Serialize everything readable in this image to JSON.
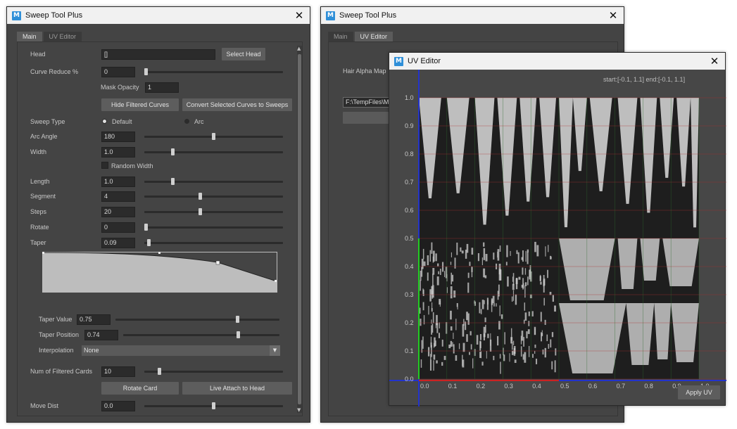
{
  "app_icon_letter": "M",
  "close_glyph": "✕",
  "left_window": {
    "title": "Sweep Tool Plus",
    "tabs": [
      {
        "label": "Main",
        "active": true
      },
      {
        "label": "UV Editor",
        "active": false
      }
    ],
    "head": {
      "label": "Head",
      "value": "[]",
      "button": "Select Head"
    },
    "curve_reduce": {
      "label": "Curve Reduce %",
      "value": "0",
      "slider": 0.0
    },
    "mask_opacity": {
      "label": "Mask Opacity",
      "value": "1"
    },
    "hide_filtered_button": "Hide Filtered Curves",
    "convert_button": "Convert Selected Curves to Sweeps",
    "sweep_type": {
      "label": "Sweep Type",
      "options": [
        "Default",
        "Arc"
      ],
      "selected": "Default"
    },
    "arc_angle": {
      "label": "Arc Angle",
      "value": "180",
      "slider": 0.5
    },
    "width": {
      "label": "Width",
      "value": "1.0",
      "slider": 0.2
    },
    "random_width": {
      "label": "Random Width",
      "checked": false
    },
    "length": {
      "label": "Length",
      "value": "1.0",
      "slider": 0.2
    },
    "segment": {
      "label": "Segment",
      "value": "4",
      "slider": 0.4
    },
    "steps": {
      "label": "Steps",
      "value": "20",
      "slider": 0.4
    },
    "rotate": {
      "label": "Rotate",
      "value": "0",
      "slider": 0.0
    },
    "taper": {
      "label": "Taper",
      "value": "0.09",
      "slider": 0.02
    },
    "taper_value": {
      "label": "Taper Value",
      "value": "0.75",
      "slider": 0.75
    },
    "taper_position": {
      "label": "Taper Position",
      "value": "0.74",
      "slider": 0.74
    },
    "interpolation": {
      "label": "Interpolation",
      "value": "None"
    },
    "num_filtered": {
      "label": "Num of Filtered Cards",
      "value": "10",
      "slider": 0.1
    },
    "rotate_card_button": "Rotate Card",
    "live_attach_button": "Live Attach to Head",
    "move_dist": {
      "label": "Move Dist",
      "value": "0.0",
      "slider": 0.5
    }
  },
  "right_window": {
    "title": "Sweep Tool Plus",
    "tabs": [
      {
        "label": "Main",
        "active": false
      },
      {
        "label": "UV Editor",
        "active": true
      }
    ],
    "hair_alpha_label": "Hair Alpha Map",
    "path_value": "F:\\TempFiles\\M"
  },
  "uv_editor": {
    "title": "UV Editor",
    "readout": "start:[-0.1, 1.1] end:[-0.1, 1.1]",
    "apply_button": "Apply UV",
    "colors": {
      "x_axis": "#2233cc",
      "y_axis": "#2233cc",
      "u_edge": "#cc2222",
      "v_edge": "#22cc22",
      "grid": "#b03030"
    },
    "y_ticks": [
      "0.0",
      "0.1",
      "0.2",
      "0.3",
      "0.4",
      "0.5",
      "0.6",
      "0.7",
      "0.8",
      "0.9",
      "1.0"
    ],
    "x_ticks": [
      "0.0",
      "0.1",
      "0.2",
      "0.3",
      "0.4",
      "0.5",
      "0.6",
      "0.7",
      "0.8",
      "0.9",
      "1.0"
    ]
  }
}
